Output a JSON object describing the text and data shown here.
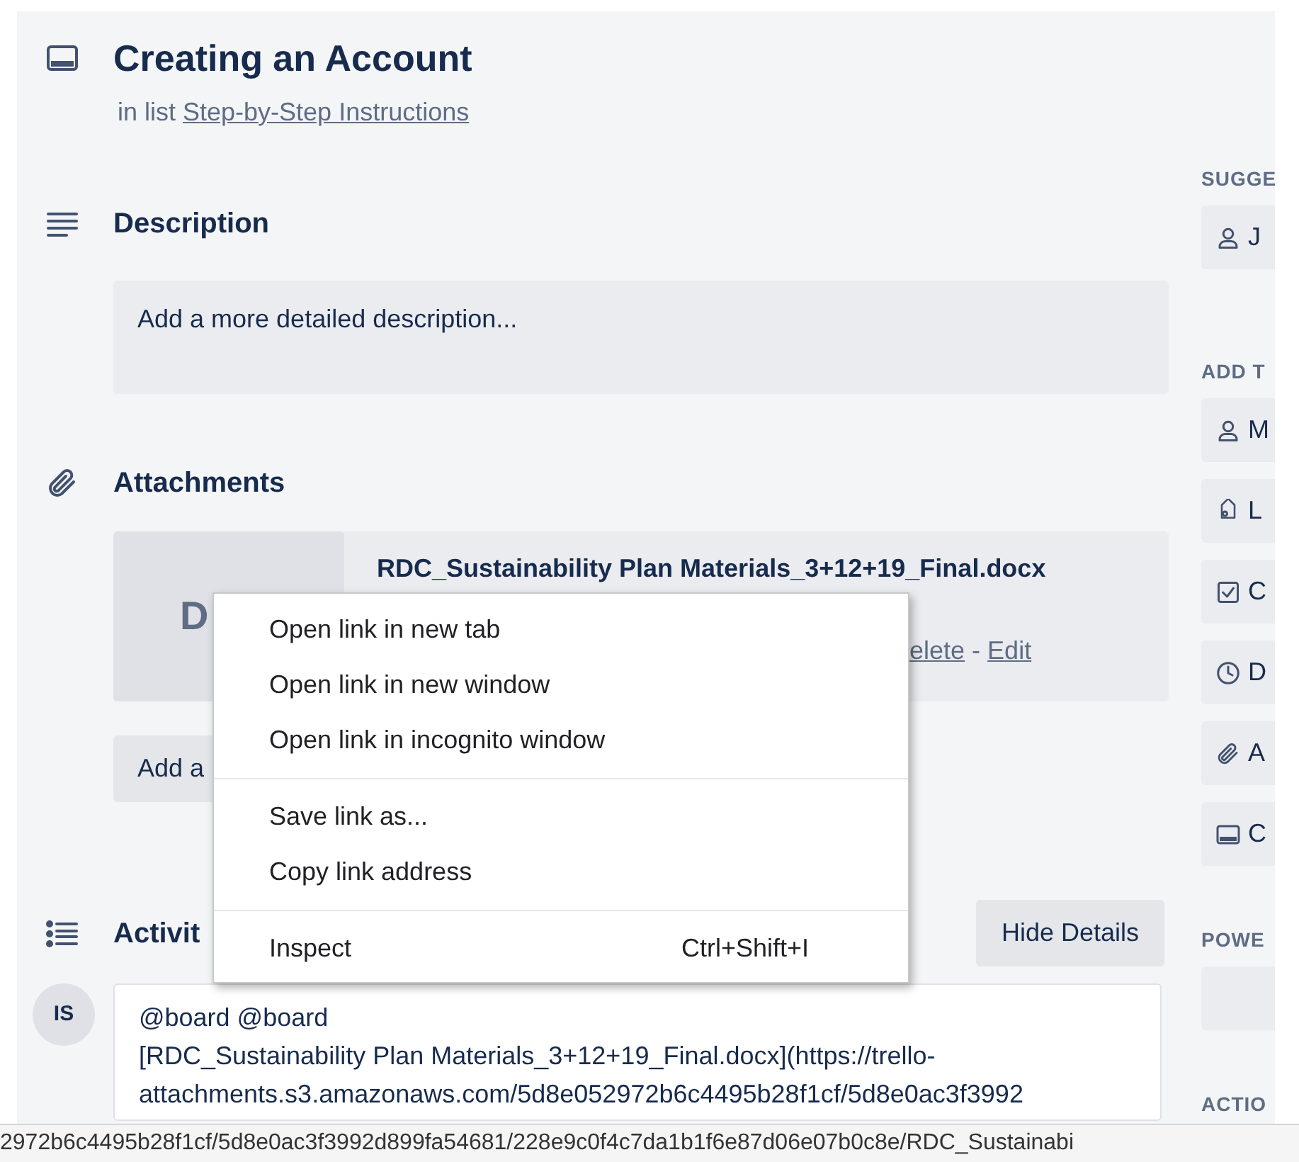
{
  "card": {
    "title": "Creating an Account",
    "list_prefix": "in list",
    "list_name": "Step-by-Step Instructions"
  },
  "description": {
    "heading": "Description",
    "placeholder": "Add a more detailed description..."
  },
  "attachments": {
    "heading": "Attachments",
    "items": [
      {
        "thumbnail": "D",
        "name": "RDC_Sustainability Plan Materials_3+12+19_Final.docx",
        "actions": [
          "elete",
          "Edit"
        ],
        "separator": "-"
      }
    ],
    "add_button": "Add a"
  },
  "activity": {
    "heading": "Activit",
    "toggle_button": "Hide Details",
    "comments": [
      {
        "avatar": "IS",
        "lines": [
          "@board @board",
          "[RDC_Sustainability Plan Materials_3+12+19_Final.docx](https://trello-",
          "attachments.s3.amazonaws.com/5d8e052972b6c4495b28f1cf/5d8e0ac3f3992"
        ]
      }
    ]
  },
  "sidebar": {
    "sections": [
      {
        "heading": "SUGGE",
        "buttons": [
          {
            "kind": "person",
            "label": "J"
          }
        ]
      },
      {
        "heading": "ADD T",
        "buttons": [
          {
            "kind": "person",
            "label": "M"
          },
          {
            "kind": "tag",
            "label": "L"
          },
          {
            "kind": "checkbox",
            "label": "C"
          },
          {
            "kind": "clock",
            "label": "D"
          },
          {
            "kind": "paperclip",
            "label": "A"
          },
          {
            "kind": "card",
            "label": "C"
          }
        ]
      },
      {
        "heading": "POWE",
        "buttons": [
          {
            "kind": "blank"
          }
        ]
      },
      {
        "heading": "ACTIO"
      }
    ]
  },
  "context_menu": {
    "groups": [
      [
        {
          "label": "Open link in new tab"
        },
        {
          "label": "Open link in new window"
        },
        {
          "label": "Open link in incognito window"
        }
      ],
      [
        {
          "label": "Save link as..."
        },
        {
          "label": "Copy link address"
        }
      ],
      [
        {
          "label": "Inspect",
          "shortcut": "Ctrl+Shift+I"
        }
      ]
    ]
  },
  "status_bar": {
    "url": "2972b6c4495b28f1cf/5d8e0ac3f3992d899fa54681/228e9c0f4c7da1b1f6e87d06e07b0c8e/RDC_Sustainabi"
  }
}
